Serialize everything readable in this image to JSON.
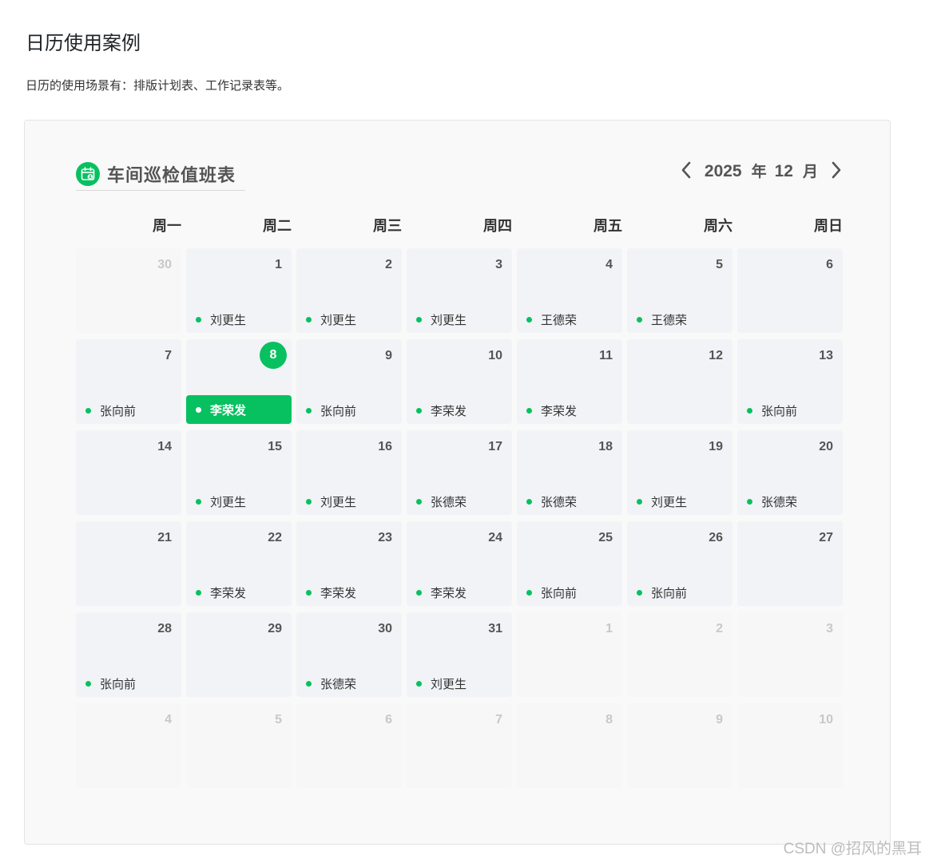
{
  "page": {
    "title": "日历使用案例",
    "description": "日历的使用场景有：排版计划表、工作记录表等。"
  },
  "calendar": {
    "title": "车间巡检值班表",
    "icon": "calendar-user-icon",
    "year": "2025",
    "year_unit": "年",
    "month": "12",
    "month_unit": "月",
    "prev_icon": "chevron-left-icon",
    "next_icon": "chevron-right-icon",
    "accent_color": "#07c160",
    "weekdays": [
      "周一",
      "周二",
      "周三",
      "周四",
      "周五",
      "周六",
      "周日"
    ],
    "days": [
      {
        "day": "30",
        "out": true,
        "name": ""
      },
      {
        "day": "1",
        "out": false,
        "name": "刘更生"
      },
      {
        "day": "2",
        "out": false,
        "name": "刘更生"
      },
      {
        "day": "3",
        "out": false,
        "name": "刘更生"
      },
      {
        "day": "4",
        "out": false,
        "name": "王德荣"
      },
      {
        "day": "5",
        "out": false,
        "name": "王德荣"
      },
      {
        "day": "6",
        "out": false,
        "name": ""
      },
      {
        "day": "7",
        "out": false,
        "name": "张向前"
      },
      {
        "day": "8",
        "out": false,
        "name": "李荣发",
        "today": true
      },
      {
        "day": "9",
        "out": false,
        "name": "张向前"
      },
      {
        "day": "10",
        "out": false,
        "name": "李荣发"
      },
      {
        "day": "11",
        "out": false,
        "name": "李荣发"
      },
      {
        "day": "12",
        "out": false,
        "name": ""
      },
      {
        "day": "13",
        "out": false,
        "name": "张向前"
      },
      {
        "day": "14",
        "out": false,
        "name": ""
      },
      {
        "day": "15",
        "out": false,
        "name": "刘更生"
      },
      {
        "day": "16",
        "out": false,
        "name": "刘更生"
      },
      {
        "day": "17",
        "out": false,
        "name": "张德荣"
      },
      {
        "day": "18",
        "out": false,
        "name": "张德荣"
      },
      {
        "day": "19",
        "out": false,
        "name": "刘更生"
      },
      {
        "day": "20",
        "out": false,
        "name": "张德荣"
      },
      {
        "day": "21",
        "out": false,
        "name": ""
      },
      {
        "day": "22",
        "out": false,
        "name": "李荣发"
      },
      {
        "day": "23",
        "out": false,
        "name": "李荣发"
      },
      {
        "day": "24",
        "out": false,
        "name": "李荣发"
      },
      {
        "day": "25",
        "out": false,
        "name": "张向前"
      },
      {
        "day": "26",
        "out": false,
        "name": "张向前"
      },
      {
        "day": "27",
        "out": false,
        "name": ""
      },
      {
        "day": "28",
        "out": false,
        "name": "张向前"
      },
      {
        "day": "29",
        "out": false,
        "name": ""
      },
      {
        "day": "30",
        "out": false,
        "name": "张德荣"
      },
      {
        "day": "31",
        "out": false,
        "name": "刘更生"
      },
      {
        "day": "1",
        "out": true,
        "name": ""
      },
      {
        "day": "2",
        "out": true,
        "name": ""
      },
      {
        "day": "3",
        "out": true,
        "name": ""
      },
      {
        "day": "4",
        "out": true,
        "name": ""
      },
      {
        "day": "5",
        "out": true,
        "name": ""
      },
      {
        "day": "6",
        "out": true,
        "name": ""
      },
      {
        "day": "7",
        "out": true,
        "name": ""
      },
      {
        "day": "8",
        "out": true,
        "name": ""
      },
      {
        "day": "9",
        "out": true,
        "name": ""
      },
      {
        "day": "10",
        "out": true,
        "name": ""
      }
    ]
  },
  "watermark": "CSDN @招风的黑耳"
}
